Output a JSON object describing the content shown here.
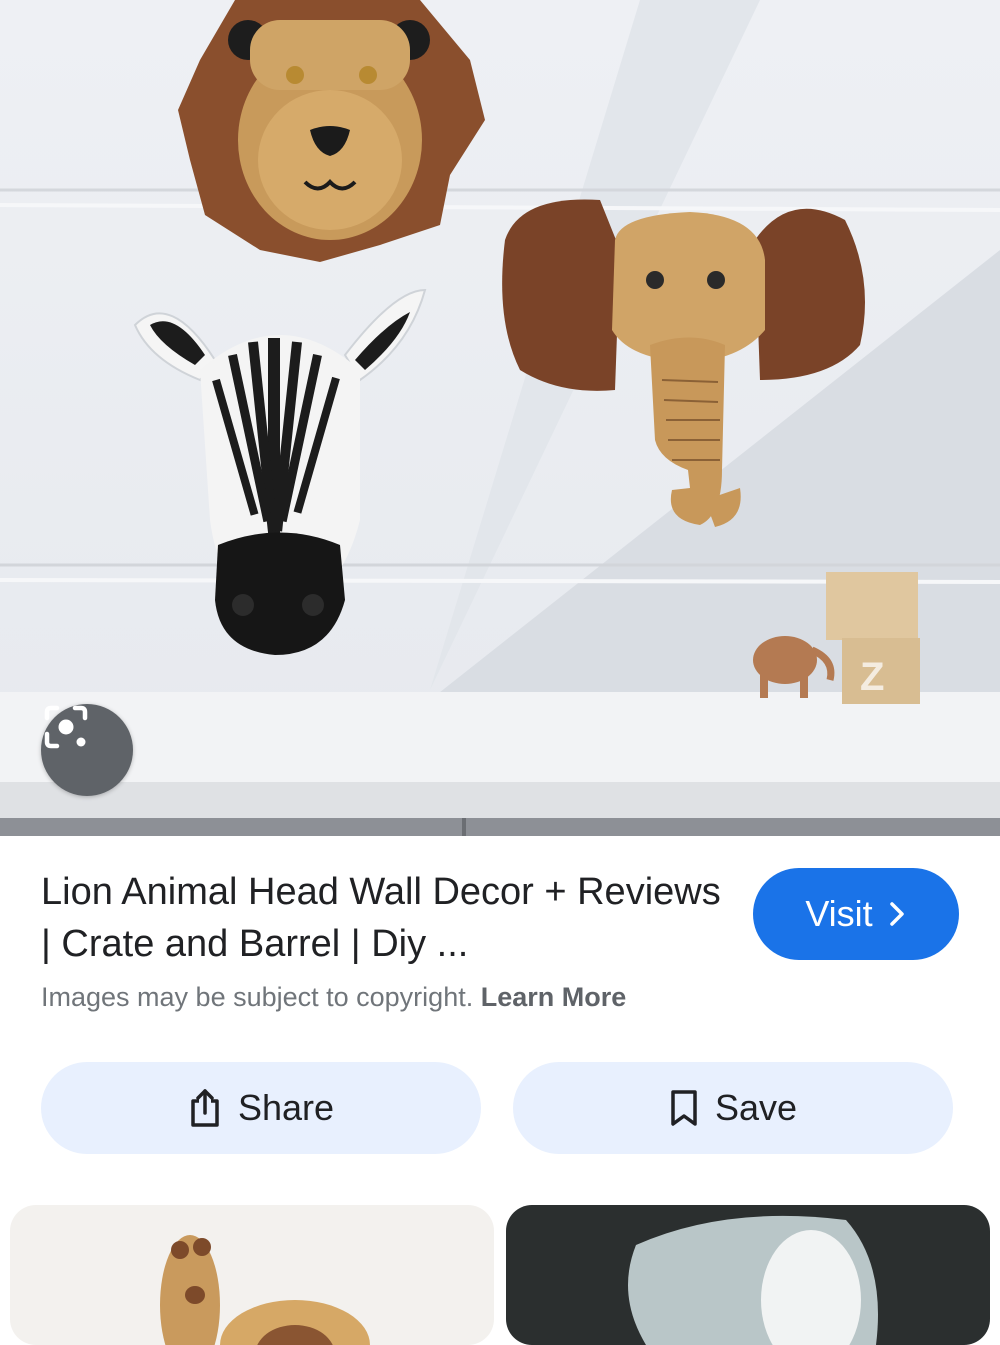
{
  "result": {
    "title": "Lion Animal Head Wall Decor + Reviews | Crate and Barrel | Diy ...",
    "copyright_text": "Images may be subject to copyright.",
    "learn_more": "Learn More",
    "visit_label": "Visit",
    "share_label": "Share",
    "save_label": "Save"
  },
  "icons": {
    "lens": "lens-camera-icon",
    "visit": "chevron-right-icon",
    "share": "share-icon",
    "save": "bookmark-icon"
  },
  "colors": {
    "visit_button": "#1a73e8",
    "action_button": "#e8f0fe",
    "title_text": "#202124",
    "muted_text": "#70757a"
  }
}
